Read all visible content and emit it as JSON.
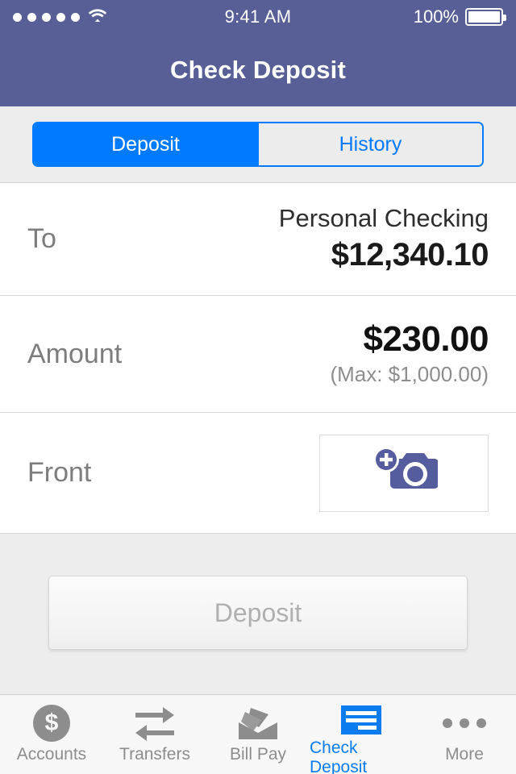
{
  "status_bar": {
    "signal_icon": "signal-dots-icon",
    "signal_dots": 5,
    "wifi_icon": "wifi-icon",
    "time": "9:41 AM",
    "battery_percent": "100%",
    "battery_icon": "battery-full-icon"
  },
  "header": {
    "title": "Check Deposit",
    "background_color": "#585f96"
  },
  "segmented_control": {
    "accent_color": "#007aff",
    "tabs": [
      {
        "label": "Deposit",
        "active": true
      },
      {
        "label": "History",
        "active": false
      }
    ]
  },
  "form": {
    "rows": [
      {
        "name": "to",
        "label": "To",
        "account_name": "Personal Checking",
        "account_balance": "$12,340.10"
      },
      {
        "name": "amount",
        "label": "Amount",
        "value": "$230.00",
        "hint": "(Max: $1,000.00)"
      },
      {
        "name": "front",
        "label": "Front",
        "capture_icon": "camera-add-icon"
      }
    ]
  },
  "action": {
    "deposit_label": "Deposit",
    "disabled": true
  },
  "tab_bar": {
    "active_color": "#0a7cf0",
    "inactive_color": "#8d8d8d",
    "items": [
      {
        "label": "Accounts",
        "icon": "dollar-circle-icon",
        "active": false
      },
      {
        "label": "Transfers",
        "icon": "transfer-arrows-icon",
        "active": false
      },
      {
        "label": "Bill Pay",
        "icon": "envelope-icon",
        "active": false
      },
      {
        "label": "Check Deposit",
        "icon": "check-icon",
        "active": true
      },
      {
        "label": "More",
        "icon": "ellipsis-icon",
        "active": false
      }
    ]
  }
}
